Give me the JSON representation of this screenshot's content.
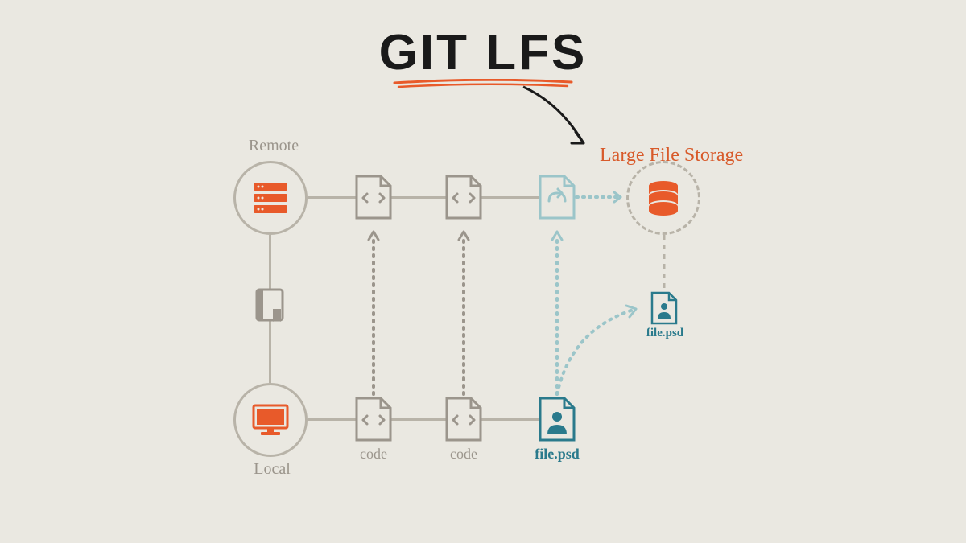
{
  "title": "GIT LFS",
  "lfs_label": "Large File Storage",
  "labels": {
    "remote": "Remote",
    "local": "Local",
    "code1": "code",
    "code2": "code",
    "file_psd_bottom": "file.psd",
    "file_psd_right": "file.psd"
  },
  "colors": {
    "bg": "#eae8e1",
    "gray": "#b8b3a8",
    "gray_text": "#9b958c",
    "orange": "#e85a2a",
    "teal_light": "#9bc5c9",
    "teal": "#2a7a8c",
    "black": "#1a1a1a"
  }
}
